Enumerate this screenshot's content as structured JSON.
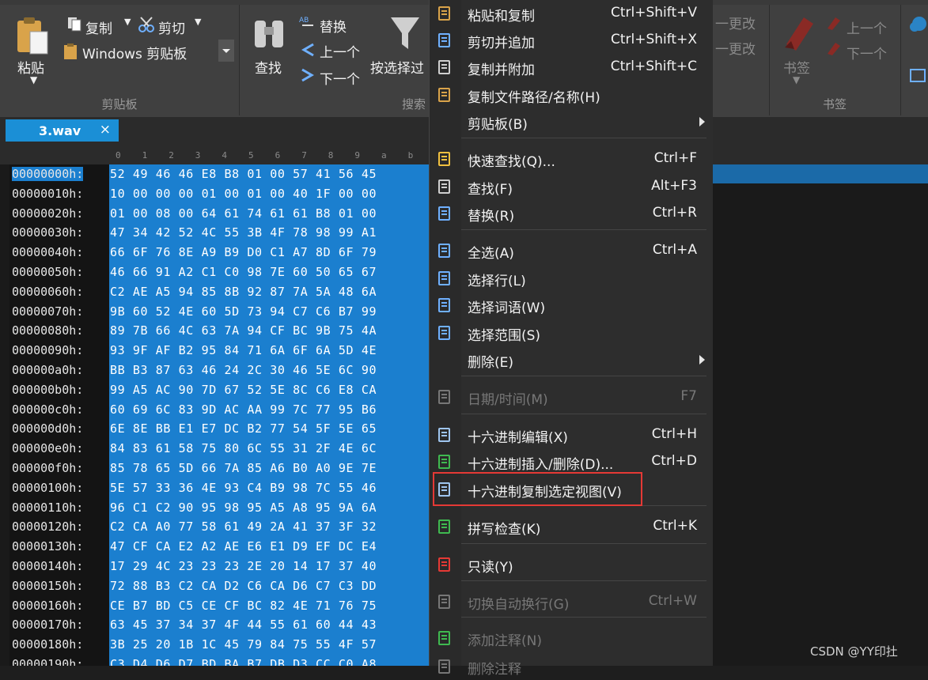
{
  "ribbon": {
    "clipboard_group": {
      "paste_label": "粘贴",
      "copy_label": "复制",
      "cut_label": "剪切",
      "clipboard_select": "Windows 剪贴板",
      "group_label": "剪贴板"
    },
    "search_group": {
      "find_label": "查找",
      "replace_label": "替换",
      "prev_label": "上一个",
      "next_label": "下一个",
      "filter_label": "按选择过",
      "group_label": "搜索"
    },
    "changes_group": {
      "prev_change": "一更改",
      "next_change": "一更改"
    },
    "bookmark_group": {
      "bookmark_label": "书签",
      "prev_label": "上一个",
      "next_label": "下一个",
      "group_label": "书签"
    }
  },
  "tab": {
    "filename": "3.wav",
    "close": "×"
  },
  "column_header": [
    "0",
    "1",
    "2",
    "3",
    "4",
    "5",
    "6",
    "7",
    "8",
    "9",
    "a",
    "b"
  ],
  "hex_rows": [
    {
      "addr": "00000000h:",
      "bytes": "52 49 46 46 E8 B8 01 00 57 41 56 45"
    },
    {
      "addr": "00000010h:",
      "bytes": "10 00 00 00 01 00 01 00 40 1F 00 00"
    },
    {
      "addr": "00000020h:",
      "bytes": "01 00 08 00 64 61 74 61 61 B8 01 00"
    },
    {
      "addr": "00000030h:",
      "bytes": "47 34 42 52 4C 55 3B 4F 78 98 99 A1"
    },
    {
      "addr": "00000040h:",
      "bytes": "66 6F 76 8E A9 B9 D0 C1 A7 8D 6F 79"
    },
    {
      "addr": "00000050h:",
      "bytes": "46 66 91 A2 C1 C0 98 7E 60 50 65 67"
    },
    {
      "addr": "00000060h:",
      "bytes": "C2 AE A5 94 85 8B 92 87 7A 5A 48 6A"
    },
    {
      "addr": "00000070h:",
      "bytes": "9B 60 52 4E 60 5D 73 94 C7 C6 B7 99"
    },
    {
      "addr": "00000080h:",
      "bytes": "89 7B 66 4C 63 7A 94 CF BC 9B 75 4A"
    },
    {
      "addr": "00000090h:",
      "bytes": "93 9F AF B2 95 84 71 6A 6F 6A 5D 4E"
    },
    {
      "addr": "000000a0h:",
      "bytes": "BB B3 87 63 46 24 2C 30 46 5E 6C 90"
    },
    {
      "addr": "000000b0h:",
      "bytes": "99 A5 AC 90 7D 67 52 5E 8C C6 E8 CA"
    },
    {
      "addr": "000000c0h:",
      "bytes": "60 69 6C 83 9D AC AA 99 7C 77 95 B6"
    },
    {
      "addr": "000000d0h:",
      "bytes": "6E 8E BB E1 E7 DC B2 77 54 5F 5E 65"
    },
    {
      "addr": "000000e0h:",
      "bytes": "84 83 61 58 75 80 6C 55 31 2F 4E 6C"
    },
    {
      "addr": "000000f0h:",
      "bytes": "85 78 65 5D 66 7A 85 A6 B0 A0 9E 7E"
    },
    {
      "addr": "00000100h:",
      "bytes": "5E 57 33 36 4E 93 C4 B9 98 7C 55 46"
    },
    {
      "addr": "00000110h:",
      "bytes": "96 C1 C2 90 95 98 95 A5 A8 95 9A 6A"
    },
    {
      "addr": "00000120h:",
      "bytes": "C2 CA A0 77 58 61 49 2A 41 37 3F 32"
    },
    {
      "addr": "00000130h:",
      "bytes": "47 CF CA E2 A2 AE E6 E1 D9 EF DC E4"
    },
    {
      "addr": "00000140h:",
      "bytes": "17 29 4C 23 23 23 2E 20 14 17 37 40"
    },
    {
      "addr": "00000150h:",
      "bytes": "72 88 B3 C2 CA D2 C6 CA D6 C7 C3 DD"
    },
    {
      "addr": "00000160h:",
      "bytes": "CE B7 BD C5 CE CF BC 82 4E 71 76 75"
    },
    {
      "addr": "00000170h:",
      "bytes": "63 45 37 34 37 4F 44 55 61 60 44 43"
    },
    {
      "addr": "00000180h:",
      "bytes": "3B 25 20 1B 1C 45 79 84 75 55 4F 57"
    },
    {
      "addr": "00000190h:",
      "bytes": "C3 D4 D6 D7 BD BA B7 DB D3 CC C0 A8"
    }
  ],
  "context_menu": {
    "items": [
      {
        "label": "粘贴和复制",
        "shortcut": "Ctrl+Shift+V",
        "icon": "paste-copy-icon",
        "disabled": false
      },
      {
        "label": "剪切并追加",
        "shortcut": "Ctrl+Shift+X",
        "icon": "cut-append-icon",
        "disabled": false
      },
      {
        "label": "复制并附加",
        "shortcut": "Ctrl+Shift+C",
        "icon": "copy-append-icon",
        "disabled": false
      },
      {
        "label": "复制文件路径/名称(H)",
        "shortcut": "",
        "icon": "copy-path-icon",
        "disabled": false
      },
      {
        "label": "剪贴板(B)",
        "shortcut": "",
        "icon": "",
        "disabled": false,
        "submenu": true
      },
      {
        "label": "快速查找(Q)...",
        "shortcut": "Ctrl+F",
        "icon": "quick-find-icon",
        "disabled": false
      },
      {
        "label": "查找(F)",
        "shortcut": "Alt+F3",
        "icon": "find-icon",
        "disabled": false
      },
      {
        "label": "替换(R)",
        "shortcut": "Ctrl+R",
        "icon": "replace-icon",
        "disabled": false
      },
      {
        "label": "全选(A)",
        "shortcut": "Ctrl+A",
        "icon": "select-all-icon",
        "disabled": false
      },
      {
        "label": "选择行(L)",
        "shortcut": "",
        "icon": "select-line-icon",
        "disabled": false
      },
      {
        "label": "选择词语(W)",
        "shortcut": "",
        "icon": "select-word-icon",
        "disabled": false
      },
      {
        "label": "选择范围(S)",
        "shortcut": "",
        "icon": "select-range-icon",
        "disabled": false
      },
      {
        "label": "删除(E)",
        "shortcut": "",
        "icon": "",
        "disabled": false,
        "submenu": true
      },
      {
        "label": "日期/时间(M)",
        "shortcut": "F7",
        "icon": "datetime-icon",
        "disabled": true
      },
      {
        "label": "十六进制编辑(X)",
        "shortcut": "Ctrl+H",
        "icon": "hex-edit-icon",
        "disabled": false
      },
      {
        "label": "十六进制插入/删除(D)...",
        "shortcut": "Ctrl+D",
        "icon": "hex-insert-icon",
        "disabled": false
      },
      {
        "label": "十六进制复制选定视图(V)",
        "shortcut": "",
        "icon": "hex-copy-view-icon",
        "disabled": false
      },
      {
        "label": "拼写检查(K)",
        "shortcut": "Ctrl+K",
        "icon": "spellcheck-icon",
        "disabled": false
      },
      {
        "label": "只读(Y)",
        "shortcut": "",
        "icon": "readonly-icon",
        "disabled": false
      },
      {
        "label": "切换自动换行(G)",
        "shortcut": "Ctrl+W",
        "icon": "wordwrap-icon",
        "disabled": true
      },
      {
        "label": "添加注释(N)",
        "shortcut": "",
        "icon": "add-comment-icon",
        "disabled": true
      },
      {
        "label": "删除注释",
        "shortcut": "",
        "icon": "delete-comment-icon",
        "disabled": true
      }
    ]
  },
  "watermark": "CSDN @YY印扗",
  "colors": {
    "selection": "#1b7fcf",
    "tab_active": "#1b8fd6",
    "highlight_box": "#e53935"
  }
}
